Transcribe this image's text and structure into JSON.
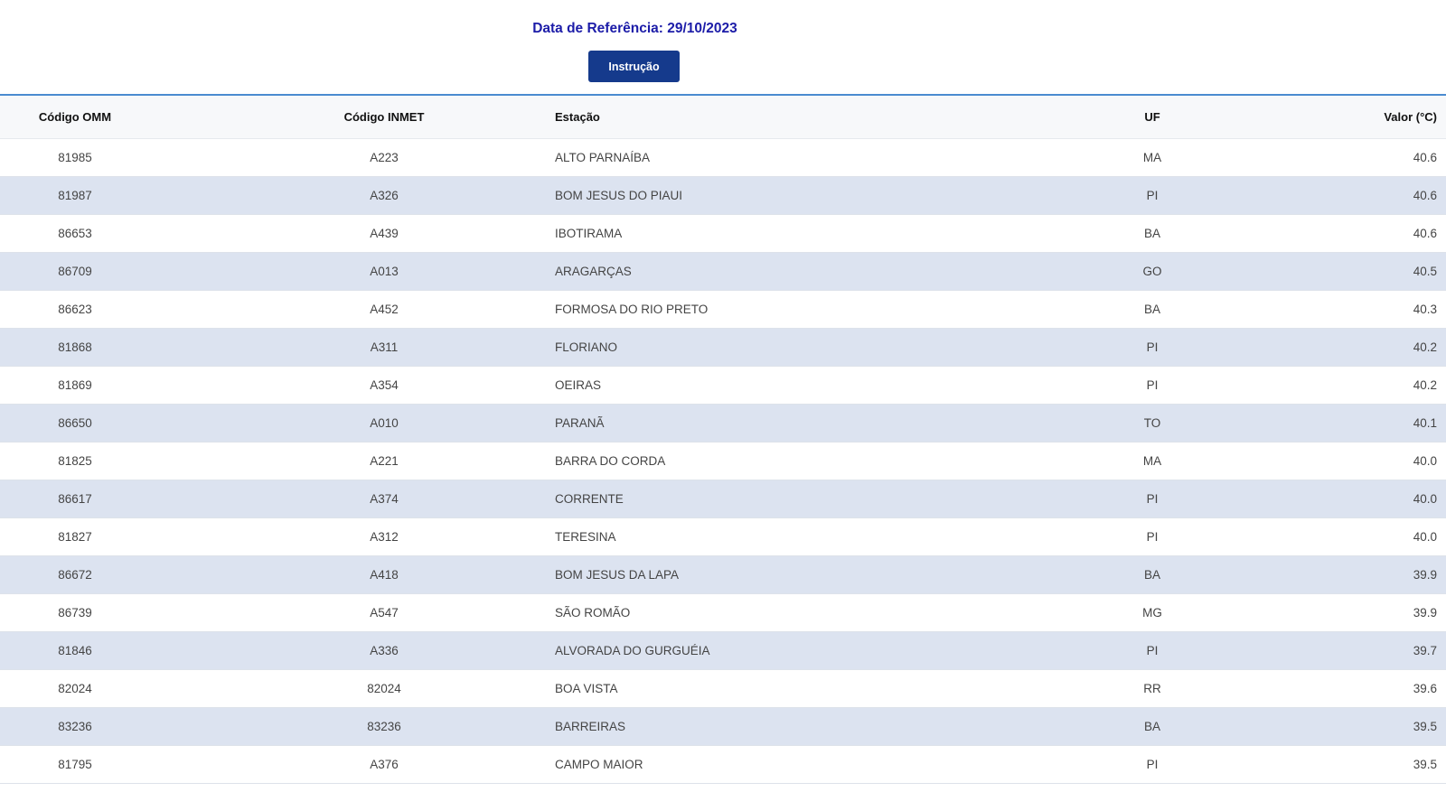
{
  "header": {
    "reference_date": "Data de Referência: 29/10/2023",
    "instruction_button": "Instrução"
  },
  "table": {
    "columns": [
      "Código OMM",
      "Código INMET",
      "Estação",
      "UF",
      "Valor (°C)"
    ],
    "rows": [
      [
        "81985",
        "A223",
        "ALTO PARNAÍBA",
        "MA",
        "40.6"
      ],
      [
        "81987",
        "A326",
        "BOM JESUS DO PIAUI",
        "PI",
        "40.6"
      ],
      [
        "86653",
        "A439",
        "IBOTIRAMA",
        "BA",
        "40.6"
      ],
      [
        "86709",
        "A013",
        "ARAGARÇAS",
        "GO",
        "40.5"
      ],
      [
        "86623",
        "A452",
        "FORMOSA DO RIO PRETO",
        "BA",
        "40.3"
      ],
      [
        "81868",
        "A311",
        "FLORIANO",
        "PI",
        "40.2"
      ],
      [
        "81869",
        "A354",
        "OEIRAS",
        "PI",
        "40.2"
      ],
      [
        "86650",
        "A010",
        "PARANÃ",
        "TO",
        "40.1"
      ],
      [
        "81825",
        "A221",
        "BARRA DO CORDA",
        "MA",
        "40.0"
      ],
      [
        "86617",
        "A374",
        "CORRENTE",
        "PI",
        "40.0"
      ],
      [
        "81827",
        "A312",
        "TERESINA",
        "PI",
        "40.0"
      ],
      [
        "86672",
        "A418",
        "BOM JESUS DA LAPA",
        "BA",
        "39.9"
      ],
      [
        "86739",
        "A547",
        "SÃO ROMÃO",
        "MG",
        "39.9"
      ],
      [
        "81846",
        "A336",
        "ALVORADA DO GURGUÉIA",
        "PI",
        "39.7"
      ],
      [
        "82024",
        "82024",
        "BOA VISTA",
        "RR",
        "39.6"
      ],
      [
        "83236",
        "83236",
        "BARREIRAS",
        "BA",
        "39.5"
      ],
      [
        "81795",
        "A376",
        "CAMPO MAIOR",
        "PI",
        "39.5"
      ]
    ]
  },
  "colors": {
    "title_text": "#1c1ca8",
    "button_bg": "#153a8c",
    "row_alt_bg": "#dce3f0",
    "table_top_border": "#4a8bd0"
  }
}
